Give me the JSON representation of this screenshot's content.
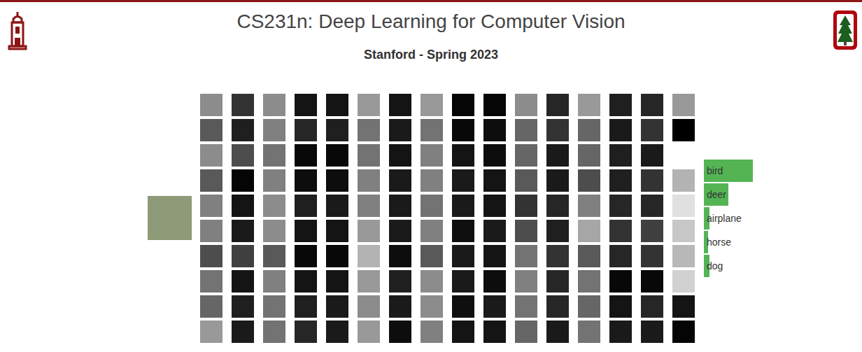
{
  "header": {
    "title": "CS231n: Deep Learning for Computer Vision",
    "subtitle": "Stanford - Spring 2023"
  },
  "activation_rows": [
    {
      "levels": [
        0.55,
        0.2,
        0.55,
        0.08,
        0.08,
        0.6,
        0.08,
        0.6,
        0.02,
        0.02,
        0.55,
        0.15,
        0.6,
        0.12,
        0.15
      ],
      "output_level": 0.6
    },
    {
      "levels": [
        0.35,
        0.12,
        0.5,
        0.15,
        0.12,
        0.45,
        0.1,
        0.45,
        0.03,
        0.05,
        0.4,
        0.2,
        0.4,
        0.1,
        0.2
      ],
      "output_level": 0
    },
    {
      "levels": [
        0.55,
        0.3,
        0.45,
        0.03,
        0.03,
        0.45,
        0.08,
        0.5,
        0.08,
        0.05,
        0.4,
        0.1,
        0.4,
        0.12,
        0.1
      ],
      "output_level": null
    },
    {
      "levels": [
        0.35,
        0.02,
        0.5,
        0.05,
        0.05,
        0.5,
        0.1,
        0.5,
        0.1,
        0.08,
        0.35,
        0.1,
        0.3,
        0.12,
        0.2
      ],
      "output_level": 0.7
    },
    {
      "levels": [
        0.5,
        0.08,
        0.55,
        0.12,
        0.1,
        0.5,
        0.1,
        0.45,
        0.1,
        0.08,
        0.2,
        0.15,
        0.5,
        0.15,
        0.15
      ],
      "output_level": 0.88
    },
    {
      "levels": [
        0.5,
        0.1,
        0.55,
        0.08,
        0.08,
        0.6,
        0.1,
        0.5,
        0.06,
        0.1,
        0.3,
        0.12,
        0.65,
        0.2,
        0.25
      ],
      "output_level": 0.78
    },
    {
      "levels": [
        0.3,
        0.25,
        0.35,
        0.03,
        0.03,
        0.7,
        0.05,
        0.35,
        0.1,
        0.08,
        0.45,
        0.2,
        0.35,
        0.15,
        0.2
      ],
      "output_level": 0.72
    },
    {
      "levels": [
        0.45,
        0.08,
        0.5,
        0.08,
        0.08,
        0.6,
        0.12,
        0.55,
        0.1,
        0.05,
        0.5,
        0.15,
        0.45,
        0.03,
        0.03
      ],
      "output_level": 0.82
    },
    {
      "levels": [
        0.4,
        0.12,
        0.45,
        0.12,
        0.1,
        0.55,
        0.1,
        0.55,
        0.06,
        0.1,
        0.45,
        0.15,
        0.4,
        0.08,
        0.15
      ],
      "output_level": 0.08
    },
    {
      "levels": [
        0.6,
        0.1,
        0.45,
        0.15,
        0.1,
        0.6,
        0.05,
        0.5,
        0.08,
        0.08,
        0.4,
        0.1,
        0.45,
        0.1,
        0.1
      ],
      "output_level": 0.02
    }
  ],
  "predictions": [
    {
      "label": "bird",
      "level": 1
    },
    {
      "label": "deer",
      "level": 0.5
    },
    {
      "label": "airplane",
      "level": 0.11
    },
    {
      "label": "horse",
      "level": 0.08
    },
    {
      "label": "dog",
      "level": 0.12
    }
  ]
}
